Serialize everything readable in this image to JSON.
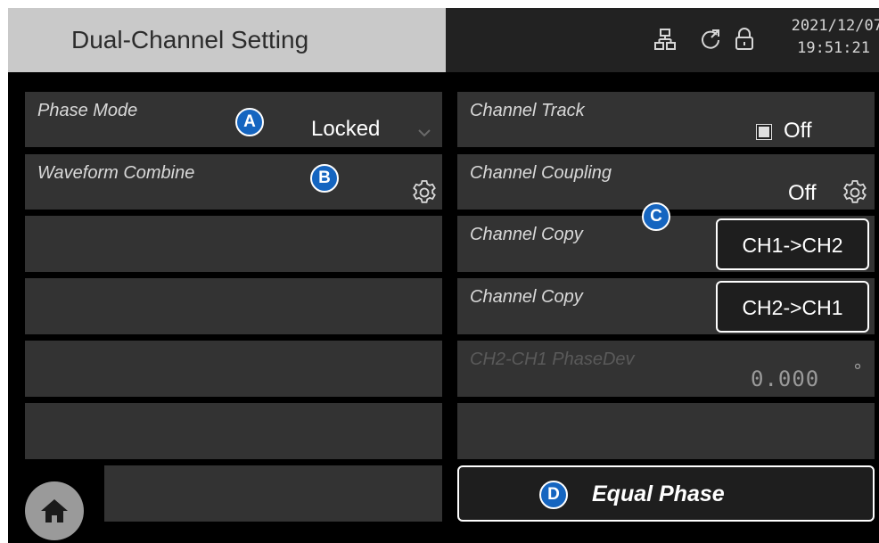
{
  "header": {
    "title": "Dual-Channel Setting",
    "date": "2021/12/07",
    "time": "19:51:21",
    "icons": [
      "network-icon",
      "sync-icon",
      "lock-icon"
    ]
  },
  "left_panels": {
    "phase_mode": {
      "label": "Phase Mode",
      "value": "Locked"
    },
    "waveform_combine": {
      "label": "Waveform Combine"
    }
  },
  "right_panels": {
    "channel_track": {
      "label": "Channel Track",
      "value": "Off"
    },
    "channel_coupling": {
      "label": "Channel Coupling",
      "value": "Off"
    },
    "channel_copy_1": {
      "label": "Channel Copy",
      "button": "CH1->CH2"
    },
    "channel_copy_2": {
      "label": "Channel Copy",
      "button": "CH2->CH1"
    },
    "phase_dev": {
      "label": "CH2-CH1 PhaseDev",
      "value": "0.000",
      "unit": "°"
    }
  },
  "actions": {
    "equal_phase": "Equal Phase"
  },
  "callouts": {
    "a": "A",
    "b": "B",
    "c": "C",
    "d": "D"
  },
  "colors": {
    "title_bg": "#c9c9c9",
    "panel_bg": "#333333",
    "callout": "#1565c0"
  }
}
